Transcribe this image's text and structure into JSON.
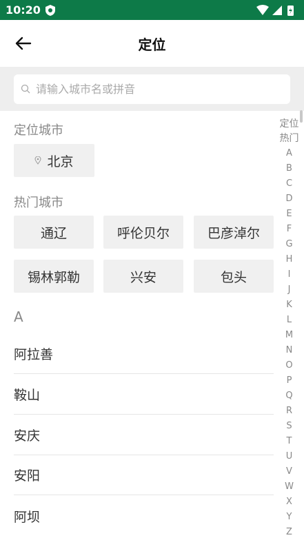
{
  "status": {
    "time": "10:20"
  },
  "header": {
    "title": "定位"
  },
  "search": {
    "placeholder": "请输入城市名或拼音"
  },
  "located": {
    "label": "定位城市",
    "city": "北京"
  },
  "hot": {
    "label": "热门城市",
    "cities": [
      "通辽",
      "呼伦贝尔",
      "巴彦淖尔",
      "锡林郭勒",
      "兴安",
      "包头"
    ]
  },
  "list": {
    "letter": "A",
    "cities": [
      "阿拉善",
      "鞍山",
      "安庆",
      "安阳",
      "阿坝"
    ]
  },
  "index": [
    "定位",
    "热门",
    "A",
    "B",
    "C",
    "D",
    "E",
    "F",
    "G",
    "H",
    "I",
    "J",
    "K",
    "L",
    "M",
    "N",
    "O",
    "P",
    "Q",
    "R",
    "S",
    "T",
    "U",
    "V",
    "W",
    "X",
    "Y",
    "Z"
  ],
  "colors": {
    "statusbar": "#0d7a48",
    "chip_bg": "#f0f0f0",
    "search_bg": "#eeeeee"
  }
}
